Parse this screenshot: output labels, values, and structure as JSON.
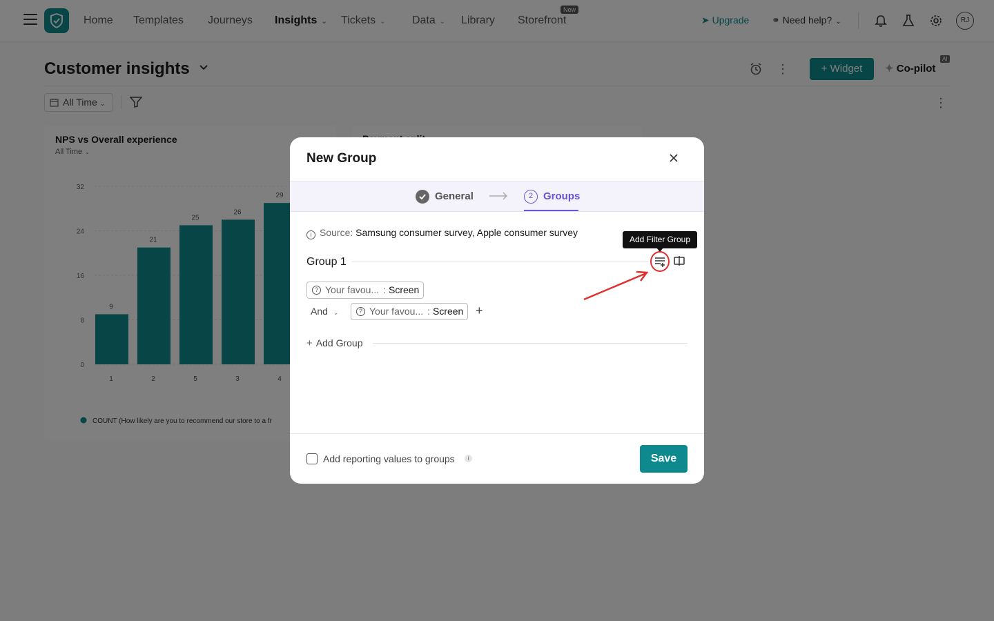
{
  "nav": {
    "items": [
      {
        "label": "Home"
      },
      {
        "label": "Templates"
      },
      {
        "label": "Journeys"
      },
      {
        "label": "Insights"
      },
      {
        "label": "Tickets"
      },
      {
        "label": "Data"
      },
      {
        "label": "Library"
      },
      {
        "label": "Storefront"
      }
    ],
    "new_badge": "New",
    "upgrade": "Upgrade",
    "need_help": "Need help?",
    "avatar": "RJ"
  },
  "page": {
    "title": "Customer insights",
    "widget_button": "Widget",
    "copilot": "Co-pilot",
    "ai_badge": "AI",
    "time_filter": "All Time"
  },
  "cards": [
    {
      "title": "NPS vs Overall experience",
      "subtitle": "All Time"
    },
    {
      "title": "Payment split"
    }
  ],
  "chart_data": {
    "type": "bar",
    "categories": [
      "1",
      "2",
      "5",
      "3",
      "4"
    ],
    "values": [
      9,
      21,
      25,
      26,
      29
    ],
    "title": "NPS vs Overall experience",
    "ylim": [
      0,
      32
    ],
    "yticks": [
      0,
      8,
      16,
      24,
      32
    ],
    "legend": "COUNT (How likely are you to recommend our store to a fr",
    "bar_color": "#0e8a8f"
  },
  "modal": {
    "title": "New Group",
    "step1": "General",
    "step2_number": "2",
    "step2": "Groups",
    "source_label": "Source:",
    "source_value": "Samsung consumer survey, Apple consumer survey",
    "group_title": "Group 1",
    "filters": [
      {
        "field": "Your favou...",
        "value": "Screen"
      },
      {
        "field": "Your favou...",
        "value": "Screen"
      }
    ],
    "conjunction": "And",
    "add_group": "Add Group",
    "checkbox_label": "Add reporting values to groups",
    "save": "Save"
  },
  "tooltip": "Add Filter Group",
  "colors": {
    "accent": "#0e8a8f",
    "step_active": "#6b54d6",
    "annotation": "#e03131"
  }
}
